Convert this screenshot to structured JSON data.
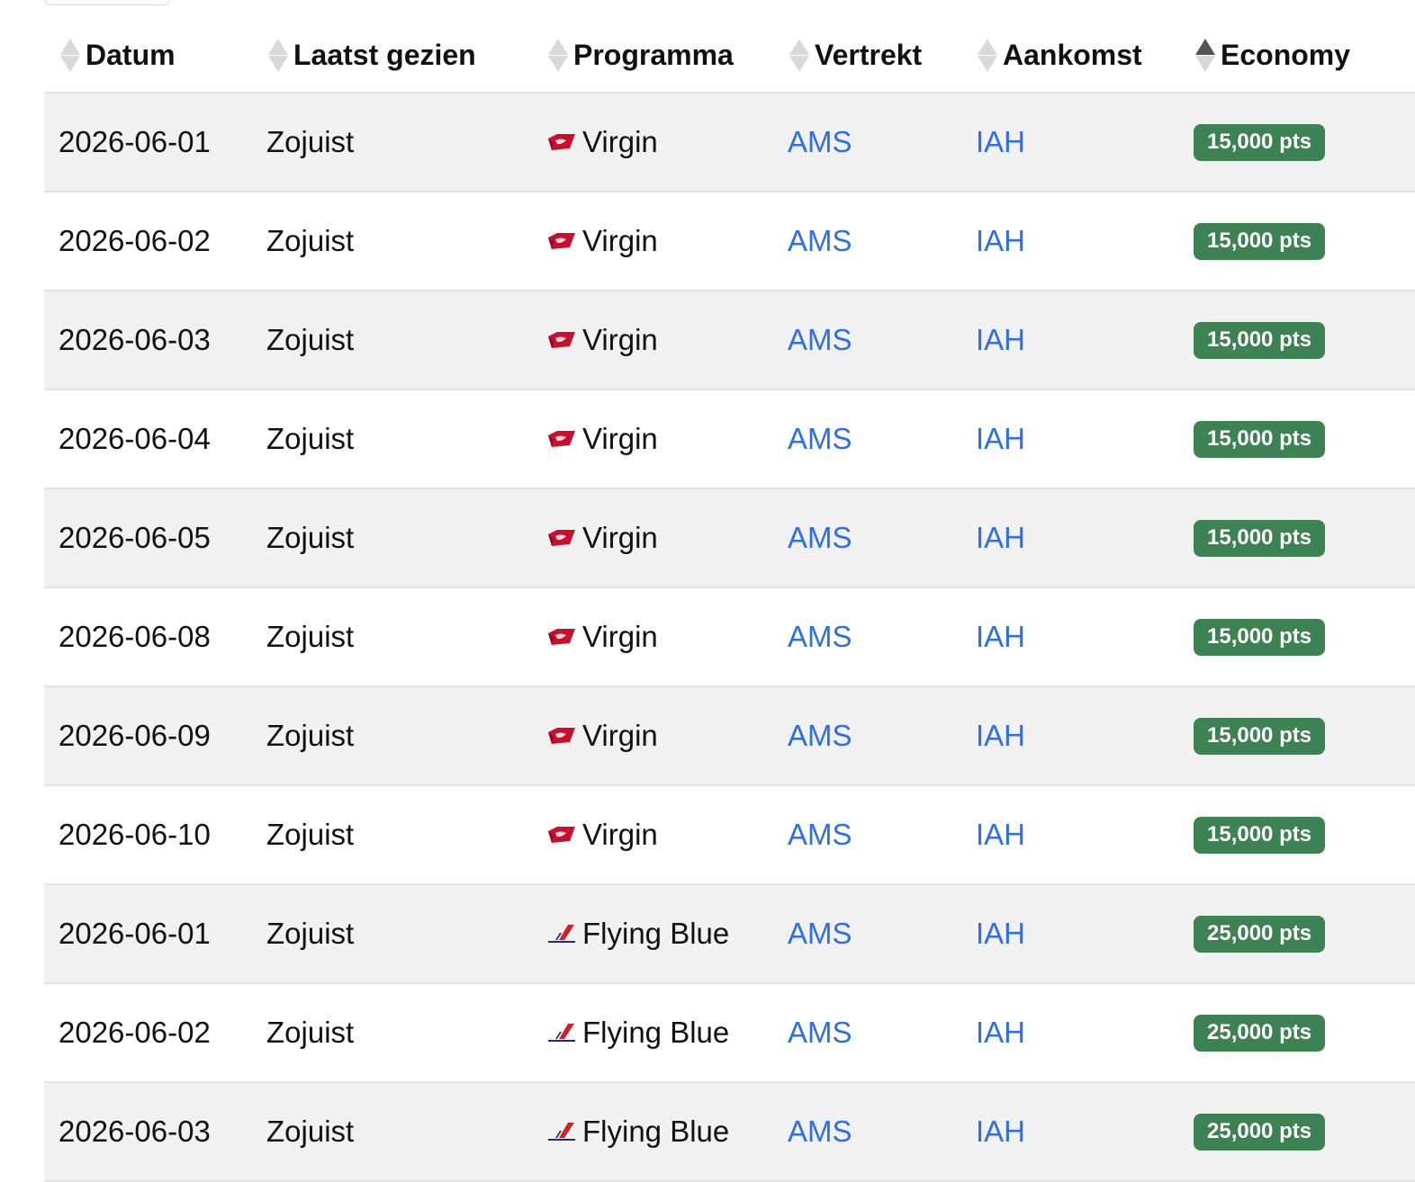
{
  "table": {
    "headers": {
      "date": "Datum",
      "last_seen": "Laatst gezien",
      "program": "Programma",
      "departure": "Vertrekt",
      "arrival": "Aankomst",
      "economy": "Economy"
    },
    "sorted_column": "economy",
    "sort_direction": "ascending",
    "colors": {
      "badge_bg": "#3d8253",
      "link": "#2f6fe0",
      "alt_row_bg": "#f1f1f1",
      "virgin_logo": "#c8102e",
      "flying_blue_logo": "#d0202a"
    },
    "rows": [
      {
        "date": "2026-06-01",
        "last_seen": "Zojuist",
        "program": "Virgin",
        "program_icon": "virgin-logo-icon",
        "departure": "AMS",
        "arrival": "IAH",
        "economy": "15,000 pts"
      },
      {
        "date": "2026-06-02",
        "last_seen": "Zojuist",
        "program": "Virgin",
        "program_icon": "virgin-logo-icon",
        "departure": "AMS",
        "arrival": "IAH",
        "economy": "15,000 pts"
      },
      {
        "date": "2026-06-03",
        "last_seen": "Zojuist",
        "program": "Virgin",
        "program_icon": "virgin-logo-icon",
        "departure": "AMS",
        "arrival": "IAH",
        "economy": "15,000 pts"
      },
      {
        "date": "2026-06-04",
        "last_seen": "Zojuist",
        "program": "Virgin",
        "program_icon": "virgin-logo-icon",
        "departure": "AMS",
        "arrival": "IAH",
        "economy": "15,000 pts"
      },
      {
        "date": "2026-06-05",
        "last_seen": "Zojuist",
        "program": "Virgin",
        "program_icon": "virgin-logo-icon",
        "departure": "AMS",
        "arrival": "IAH",
        "economy": "15,000 pts"
      },
      {
        "date": "2026-06-08",
        "last_seen": "Zojuist",
        "program": "Virgin",
        "program_icon": "virgin-logo-icon",
        "departure": "AMS",
        "arrival": "IAH",
        "economy": "15,000 pts"
      },
      {
        "date": "2026-06-09",
        "last_seen": "Zojuist",
        "program": "Virgin",
        "program_icon": "virgin-logo-icon",
        "departure": "AMS",
        "arrival": "IAH",
        "economy": "15,000 pts"
      },
      {
        "date": "2026-06-10",
        "last_seen": "Zojuist",
        "program": "Virgin",
        "program_icon": "virgin-logo-icon",
        "departure": "AMS",
        "arrival": "IAH",
        "economy": "15,000 pts"
      },
      {
        "date": "2026-06-01",
        "last_seen": "Zojuist",
        "program": "Flying Blue",
        "program_icon": "air-france-logo-icon",
        "departure": "AMS",
        "arrival": "IAH",
        "economy": "25,000 pts"
      },
      {
        "date": "2026-06-02",
        "last_seen": "Zojuist",
        "program": "Flying Blue",
        "program_icon": "air-france-logo-icon",
        "departure": "AMS",
        "arrival": "IAH",
        "economy": "25,000 pts"
      },
      {
        "date": "2026-06-03",
        "last_seen": "Zojuist",
        "program": "Flying Blue",
        "program_icon": "air-france-logo-icon",
        "departure": "AMS",
        "arrival": "IAH",
        "economy": "25,000 pts"
      }
    ]
  }
}
